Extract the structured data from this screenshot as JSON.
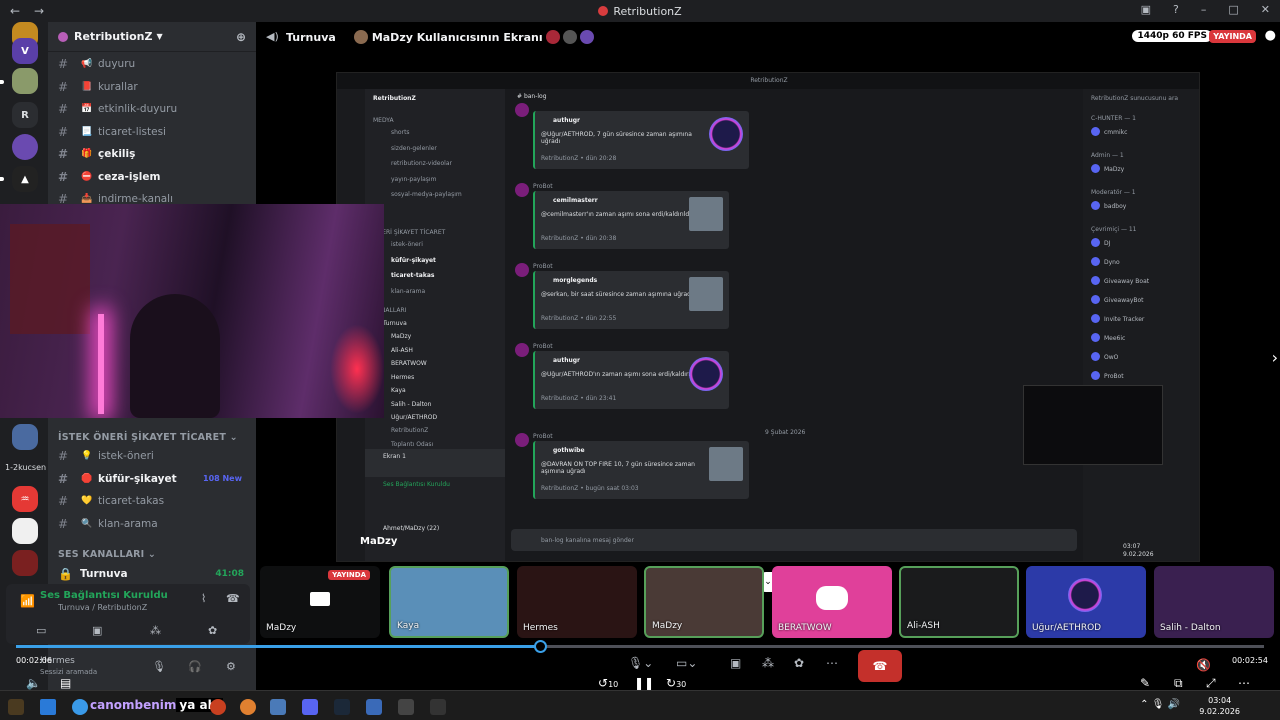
{
  "window": {
    "title": "RetributionZ"
  },
  "server": {
    "name": "RetributionZ"
  },
  "rail": {
    "letter": "R",
    "label": "1-2kucsen"
  },
  "channels": [
    {
      "name": "duyuru",
      "emoji": "📢",
      "bold": false
    },
    {
      "name": "kurallar",
      "emoji": "📕",
      "bold": false
    },
    {
      "name": "etkinlik-duyuru",
      "emoji": "📅",
      "bold": false
    },
    {
      "name": "ticaret-listesi",
      "emoji": "📃",
      "bold": false
    },
    {
      "name": "çekiliş",
      "emoji": "🎁",
      "bold": true
    },
    {
      "name": "ceza-işlem",
      "emoji": "⛔",
      "bold": true
    },
    {
      "name": "indirme-kanalı",
      "emoji": "📥",
      "bold": false
    }
  ],
  "category2": {
    "title": "İSTEK ÖNERİ ŞİKAYET TİCARET"
  },
  "channels2": [
    {
      "name": "istek-öneri",
      "emoji": "💡",
      "bold": false,
      "badge": ""
    },
    {
      "name": "küfür-şikayet",
      "emoji": "🛑",
      "bold": true,
      "badge": "108 New"
    },
    {
      "name": "ticaret-takas",
      "emoji": "💛",
      "bold": false,
      "badge": ""
    },
    {
      "name": "klan-arama",
      "emoji": "🔍",
      "bold": false,
      "badge": ""
    }
  ],
  "voice_category": {
    "title": "SES KANALLARI"
  },
  "voice_channel": {
    "name": "Turnuva",
    "timer": "41:08"
  },
  "voice_panel": {
    "status": "Ses Bağlantısı Kuruldu",
    "sub": "Turnuva / RetributionZ"
  },
  "user_panel": {
    "name": "Hermes",
    "sub": "Sessizi aramada"
  },
  "topbar": {
    "channel": "Turnuva",
    "stream_title": "MaDzy Kullanıcısının Ekranı",
    "quality": "1440p 60 FPS",
    "live": "YAYINDA"
  },
  "shared_screen": {
    "title": "RetributionZ",
    "channel": "ban-log",
    "server": "RetributionZ",
    "sidebar": {
      "section1": "MEDYA",
      "channels": [
        "shorts",
        "sizden-gelenler",
        "retributionz-videolar",
        "yayın-paylaşım",
        "sosyal-medya-paylaşım"
      ],
      "section2": "ÖNERİ ŞİKAYET TİCARET",
      "channels2": [
        "istek-öneri",
        "küfür-şikayet",
        "ticaret-takas",
        "klan-arama"
      ],
      "section3": "KANALLARI",
      "voice": "Turnuva",
      "voice_users": [
        "MaDzy",
        "Ali-ASH",
        "BERATWOW",
        "Hermes",
        "Kaya",
        "Salih - Dalton",
        "Uğur/AETHROD"
      ],
      "voice_tail": [
        "RetributionZ",
        "Toplantı Odası"
      ],
      "screen_share": "Ekran 1",
      "status": "Ses Bağlantısı Kuruldu",
      "user": "Ahmet/MaDzy (22)"
    },
    "messages": [
      {
        "author": "authugr",
        "text": "@Uğur/AETHROD, 7 gün süresince zaman aşımına uğradı",
        "footer": "RetributionZ • dün 20:28"
      },
      {
        "author": "cemilmasterr",
        "text": "@cemilmasterr'ın zaman aşımı sona erdi/kaldırıldı",
        "footer": "RetributionZ • dün 20:38"
      },
      {
        "author": "morglegends",
        "text": "@serkan, bir saat süresince zaman aşımına uğradı",
        "footer": "RetributionZ • dün 22:55"
      },
      {
        "author": "authugr",
        "text": "@Uğur/AETHROD'ın zaman aşımı sona erdi/kaldırıldı",
        "footer": "RetributionZ • dün 23:41"
      },
      {
        "author": "gothwibe",
        "text": "@DAVRAN ON TOP FIRE 10, 7 gün süresince zaman aşımına uğradı",
        "footer": "RetributionZ • bugün saat 03:03"
      }
    ],
    "bot_name": "ProBot",
    "date_divider": "9 Şubat 2026",
    "composer": "ban-log kanalına mesaj gönder",
    "members": [
      {
        "group": "C-HUNTER — 1",
        "names": [
          "cmmikc"
        ]
      },
      {
        "group": "Admin — 1",
        "names": [
          "MaDzy"
        ]
      },
      {
        "group": "Moderatör — 1",
        "names": [
          "badboy"
        ]
      },
      {
        "group": "Çevrimiçi — 11",
        "names": [
          "DJ",
          "Dyno",
          "Giveaway Boat",
          "GiveawayBot",
          "Invite Tracker",
          "Mee6ic",
          "OwO",
          "ProBot"
        ]
      }
    ],
    "search": "RetributionZ sunucusunu ara",
    "clock": [
      "03:07",
      "9.02.2026"
    ]
  },
  "participants": [
    {
      "name": "MaDzy",
      "live": "YAYINDA",
      "color": "#0e0f10"
    },
    {
      "name": "Kaya",
      "color": "#5a8fb8"
    },
    {
      "name": "Hermes",
      "color": "#2a1414"
    },
    {
      "name": "MaDzy",
      "color": "#4a3a36"
    },
    {
      "name": "BERATWOW",
      "color": "#e0409a"
    },
    {
      "name": "Ali-ASH",
      "color": "#1a1b1c"
    },
    {
      "name": "Uğur/AETHROD",
      "color": "#2c3aa8"
    },
    {
      "name": "Salih - Dalton",
      "color": "#3a2050"
    }
  ],
  "stream_label": "MaDzy",
  "playback": {
    "current": "00:02:06",
    "total": "00:02:54",
    "progress": 0.42,
    "skip_back": "10",
    "skip_fwd": "30"
  },
  "caption": {
    "part1": "canombenim",
    "part2": "ya abi"
  },
  "taskbar_clock": {
    "time": "03:04",
    "date": "9.02.2026"
  }
}
